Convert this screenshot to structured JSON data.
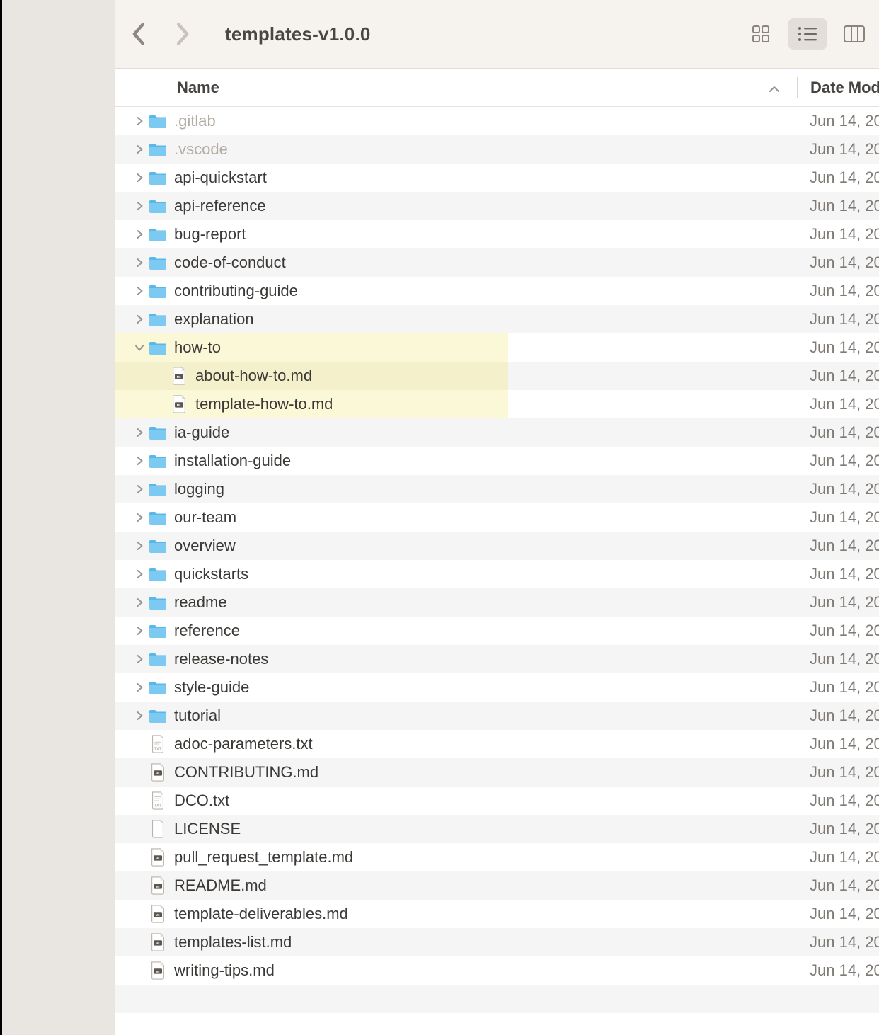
{
  "window": {
    "title": "templates-v1.0.0"
  },
  "columns": {
    "name": "Name",
    "date": "Date Modif"
  },
  "rows": [
    {
      "name": ".gitlab",
      "type": "folder",
      "date": "Jun 14, 20",
      "expanded": false,
      "indent": 0,
      "dimmed": true
    },
    {
      "name": ".vscode",
      "type": "folder",
      "date": "Jun 14, 20",
      "expanded": false,
      "indent": 0,
      "dimmed": true
    },
    {
      "name": "api-quickstart",
      "type": "folder",
      "date": "Jun 14, 20",
      "expanded": false,
      "indent": 0
    },
    {
      "name": "api-reference",
      "type": "folder",
      "date": "Jun 14, 20",
      "expanded": false,
      "indent": 0
    },
    {
      "name": "bug-report",
      "type": "folder",
      "date": "Jun 14, 20",
      "expanded": false,
      "indent": 0
    },
    {
      "name": "code-of-conduct",
      "type": "folder",
      "date": "Jun 14, 20",
      "expanded": false,
      "indent": 0
    },
    {
      "name": "contributing-guide",
      "type": "folder",
      "date": "Jun 14, 20",
      "expanded": false,
      "indent": 0
    },
    {
      "name": "explanation",
      "type": "folder",
      "date": "Jun 14, 20",
      "expanded": false,
      "indent": 0
    },
    {
      "name": "how-to",
      "type": "folder",
      "date": "Jun 14, 20",
      "expanded": true,
      "indent": 0,
      "highlight": true
    },
    {
      "name": "about-how-to.md",
      "type": "md",
      "date": "Jun 14, 20",
      "indent": 1,
      "highlight": true
    },
    {
      "name": "template-how-to.md",
      "type": "md",
      "date": "Jun 14, 20",
      "indent": 1,
      "highlight": true
    },
    {
      "name": "ia-guide",
      "type": "folder",
      "date": "Jun 14, 20",
      "expanded": false,
      "indent": 0
    },
    {
      "name": "installation-guide",
      "type": "folder",
      "date": "Jun 14, 20",
      "expanded": false,
      "indent": 0
    },
    {
      "name": "logging",
      "type": "folder",
      "date": "Jun 14, 20",
      "expanded": false,
      "indent": 0
    },
    {
      "name": "our-team",
      "type": "folder",
      "date": "Jun 14, 20",
      "expanded": false,
      "indent": 0
    },
    {
      "name": "overview",
      "type": "folder",
      "date": "Jun 14, 20",
      "expanded": false,
      "indent": 0
    },
    {
      "name": "quickstarts",
      "type": "folder",
      "date": "Jun 14, 20",
      "expanded": false,
      "indent": 0
    },
    {
      "name": "readme",
      "type": "folder",
      "date": "Jun 14, 20",
      "expanded": false,
      "indent": 0
    },
    {
      "name": "reference",
      "type": "folder",
      "date": "Jun 14, 20",
      "expanded": false,
      "indent": 0
    },
    {
      "name": "release-notes",
      "type": "folder",
      "date": "Jun 14, 20",
      "expanded": false,
      "indent": 0
    },
    {
      "name": "style-guide",
      "type": "folder",
      "date": "Jun 14, 20",
      "expanded": false,
      "indent": 0
    },
    {
      "name": "tutorial",
      "type": "folder",
      "date": "Jun 14, 20",
      "expanded": false,
      "indent": 0
    },
    {
      "name": "adoc-parameters.txt",
      "type": "txt",
      "date": "Jun 14, 20",
      "indent": 0
    },
    {
      "name": "CONTRIBUTING.md",
      "type": "md",
      "date": "Jun 14, 20",
      "indent": 0
    },
    {
      "name": "DCO.txt",
      "type": "txt",
      "date": "Jun 14, 20",
      "indent": 0
    },
    {
      "name": "LICENSE",
      "type": "blank",
      "date": "Jun 14, 20",
      "indent": 0
    },
    {
      "name": "pull_request_template.md",
      "type": "md",
      "date": "Jun 14, 20",
      "indent": 0
    },
    {
      "name": "README.md",
      "type": "md",
      "date": "Jun 14, 20",
      "indent": 0
    },
    {
      "name": "template-deliverables.md",
      "type": "md",
      "date": "Jun 14, 20",
      "indent": 0
    },
    {
      "name": "templates-list.md",
      "type": "md",
      "date": "Jun 14, 20",
      "indent": 0
    },
    {
      "name": "writing-tips.md",
      "type": "md",
      "date": "Jun 14, 20",
      "indent": 0
    }
  ]
}
